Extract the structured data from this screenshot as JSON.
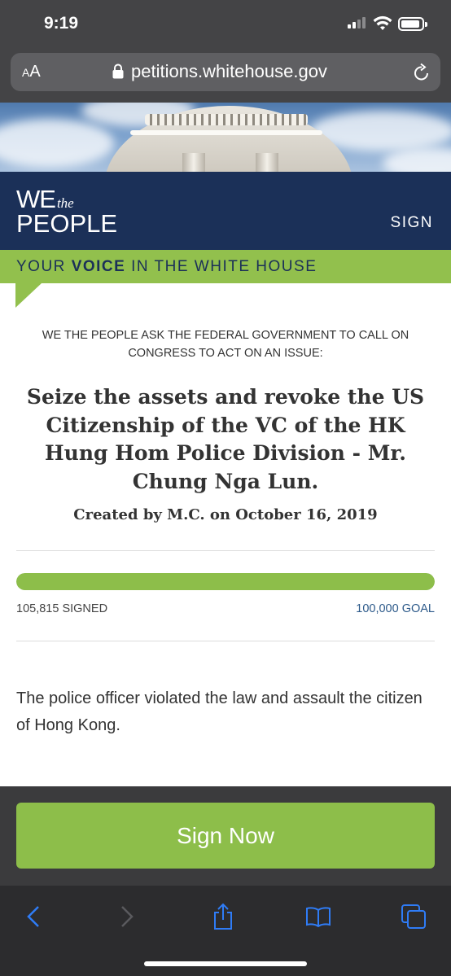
{
  "status_bar": {
    "time": "9:19"
  },
  "browser": {
    "reader_label_big": "A",
    "reader_label_small": "A",
    "url": "petitions.whitehouse.gov"
  },
  "header": {
    "logo_we": "WE",
    "logo_the": "the",
    "logo_people": "PEOPLE",
    "sign_label": "SIGN"
  },
  "tagline": {
    "prefix": "YOUR ",
    "emphasis": "VOICE",
    "suffix": " IN THE WHITE HOUSE"
  },
  "petition": {
    "ask": "WE THE PEOPLE ASK THE FEDERAL GOVERNMENT TO CALL ON CONGRESS TO ACT ON AN ISSUE:",
    "title": "Seize the assets and revoke the US Citizenship of the VC of the HK Hung Hom Police Division - Mr. Chung Nga Lun.",
    "created_by": "Created by M.C. on October 16, 2019",
    "signed_label": "105,815 SIGNED",
    "goal_label": "100,000 GOAL",
    "progress_fraction": 1.0,
    "description": "The police officer violated the law and assault the citizen of Hong Kong."
  },
  "cta": {
    "sign_now_label": "Sign Now"
  },
  "colors": {
    "navy": "#1b3058",
    "green": "#92c04d",
    "progress_green": "#8dbe4a",
    "link_blue": "#2d5a8a",
    "ios_blue": "#2f7cf6"
  },
  "toolbar": {
    "icons": [
      "back-icon",
      "forward-icon",
      "share-icon",
      "bookmarks-icon",
      "tabs-icon"
    ]
  }
}
